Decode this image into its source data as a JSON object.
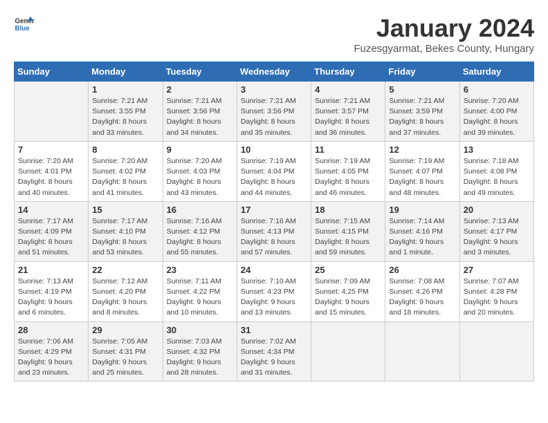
{
  "logo": {
    "text_general": "General",
    "text_blue": "Blue"
  },
  "title": "January 2024",
  "subtitle": "Fuzesgyarmat, Bekes County, Hungary",
  "days_of_week": [
    "Sunday",
    "Monday",
    "Tuesday",
    "Wednesday",
    "Thursday",
    "Friday",
    "Saturday"
  ],
  "weeks": [
    [
      {
        "day": "",
        "sunrise": "",
        "sunset": "",
        "daylight": ""
      },
      {
        "day": "1",
        "sunrise": "7:21 AM",
        "sunset": "3:55 PM",
        "daylight": "8 hours and 33 minutes."
      },
      {
        "day": "2",
        "sunrise": "7:21 AM",
        "sunset": "3:56 PM",
        "daylight": "8 hours and 34 minutes."
      },
      {
        "day": "3",
        "sunrise": "7:21 AM",
        "sunset": "3:56 PM",
        "daylight": "8 hours and 35 minutes."
      },
      {
        "day": "4",
        "sunrise": "7:21 AM",
        "sunset": "3:57 PM",
        "daylight": "8 hours and 36 minutes."
      },
      {
        "day": "5",
        "sunrise": "7:21 AM",
        "sunset": "3:59 PM",
        "daylight": "8 hours and 37 minutes."
      },
      {
        "day": "6",
        "sunrise": "7:20 AM",
        "sunset": "4:00 PM",
        "daylight": "8 hours and 39 minutes."
      }
    ],
    [
      {
        "day": "7",
        "sunrise": "7:20 AM",
        "sunset": "4:01 PM",
        "daylight": "8 hours and 40 minutes."
      },
      {
        "day": "8",
        "sunrise": "7:20 AM",
        "sunset": "4:02 PM",
        "daylight": "8 hours and 41 minutes."
      },
      {
        "day": "9",
        "sunrise": "7:20 AM",
        "sunset": "4:03 PM",
        "daylight": "8 hours and 43 minutes."
      },
      {
        "day": "10",
        "sunrise": "7:19 AM",
        "sunset": "4:04 PM",
        "daylight": "8 hours and 44 minutes."
      },
      {
        "day": "11",
        "sunrise": "7:19 AM",
        "sunset": "4:05 PM",
        "daylight": "8 hours and 46 minutes."
      },
      {
        "day": "12",
        "sunrise": "7:19 AM",
        "sunset": "4:07 PM",
        "daylight": "8 hours and 48 minutes."
      },
      {
        "day": "13",
        "sunrise": "7:18 AM",
        "sunset": "4:08 PM",
        "daylight": "8 hours and 49 minutes."
      }
    ],
    [
      {
        "day": "14",
        "sunrise": "7:17 AM",
        "sunset": "4:09 PM",
        "daylight": "8 hours and 51 minutes."
      },
      {
        "day": "15",
        "sunrise": "7:17 AM",
        "sunset": "4:10 PM",
        "daylight": "8 hours and 53 minutes."
      },
      {
        "day": "16",
        "sunrise": "7:16 AM",
        "sunset": "4:12 PM",
        "daylight": "8 hours and 55 minutes."
      },
      {
        "day": "17",
        "sunrise": "7:16 AM",
        "sunset": "4:13 PM",
        "daylight": "8 hours and 57 minutes."
      },
      {
        "day": "18",
        "sunrise": "7:15 AM",
        "sunset": "4:15 PM",
        "daylight": "8 hours and 59 minutes."
      },
      {
        "day": "19",
        "sunrise": "7:14 AM",
        "sunset": "4:16 PM",
        "daylight": "9 hours and 1 minute."
      },
      {
        "day": "20",
        "sunrise": "7:13 AM",
        "sunset": "4:17 PM",
        "daylight": "9 hours and 3 minutes."
      }
    ],
    [
      {
        "day": "21",
        "sunrise": "7:13 AM",
        "sunset": "4:19 PM",
        "daylight": "9 hours and 6 minutes."
      },
      {
        "day": "22",
        "sunrise": "7:12 AM",
        "sunset": "4:20 PM",
        "daylight": "9 hours and 8 minutes."
      },
      {
        "day": "23",
        "sunrise": "7:11 AM",
        "sunset": "4:22 PM",
        "daylight": "9 hours and 10 minutes."
      },
      {
        "day": "24",
        "sunrise": "7:10 AM",
        "sunset": "4:23 PM",
        "daylight": "9 hours and 13 minutes."
      },
      {
        "day": "25",
        "sunrise": "7:09 AM",
        "sunset": "4:25 PM",
        "daylight": "9 hours and 15 minutes."
      },
      {
        "day": "26",
        "sunrise": "7:08 AM",
        "sunset": "4:26 PM",
        "daylight": "9 hours and 18 minutes."
      },
      {
        "day": "27",
        "sunrise": "7:07 AM",
        "sunset": "4:28 PM",
        "daylight": "9 hours and 20 minutes."
      }
    ],
    [
      {
        "day": "28",
        "sunrise": "7:06 AM",
        "sunset": "4:29 PM",
        "daylight": "9 hours and 23 minutes."
      },
      {
        "day": "29",
        "sunrise": "7:05 AM",
        "sunset": "4:31 PM",
        "daylight": "9 hours and 25 minutes."
      },
      {
        "day": "30",
        "sunrise": "7:03 AM",
        "sunset": "4:32 PM",
        "daylight": "9 hours and 28 minutes."
      },
      {
        "day": "31",
        "sunrise": "7:02 AM",
        "sunset": "4:34 PM",
        "daylight": "9 hours and 31 minutes."
      },
      {
        "day": "",
        "sunrise": "",
        "sunset": "",
        "daylight": ""
      },
      {
        "day": "",
        "sunrise": "",
        "sunset": "",
        "daylight": ""
      },
      {
        "day": "",
        "sunrise": "",
        "sunset": "",
        "daylight": ""
      }
    ]
  ],
  "labels": {
    "sunrise_prefix": "Sunrise: ",
    "sunset_prefix": "Sunset: ",
    "daylight_prefix": "Daylight: "
  }
}
